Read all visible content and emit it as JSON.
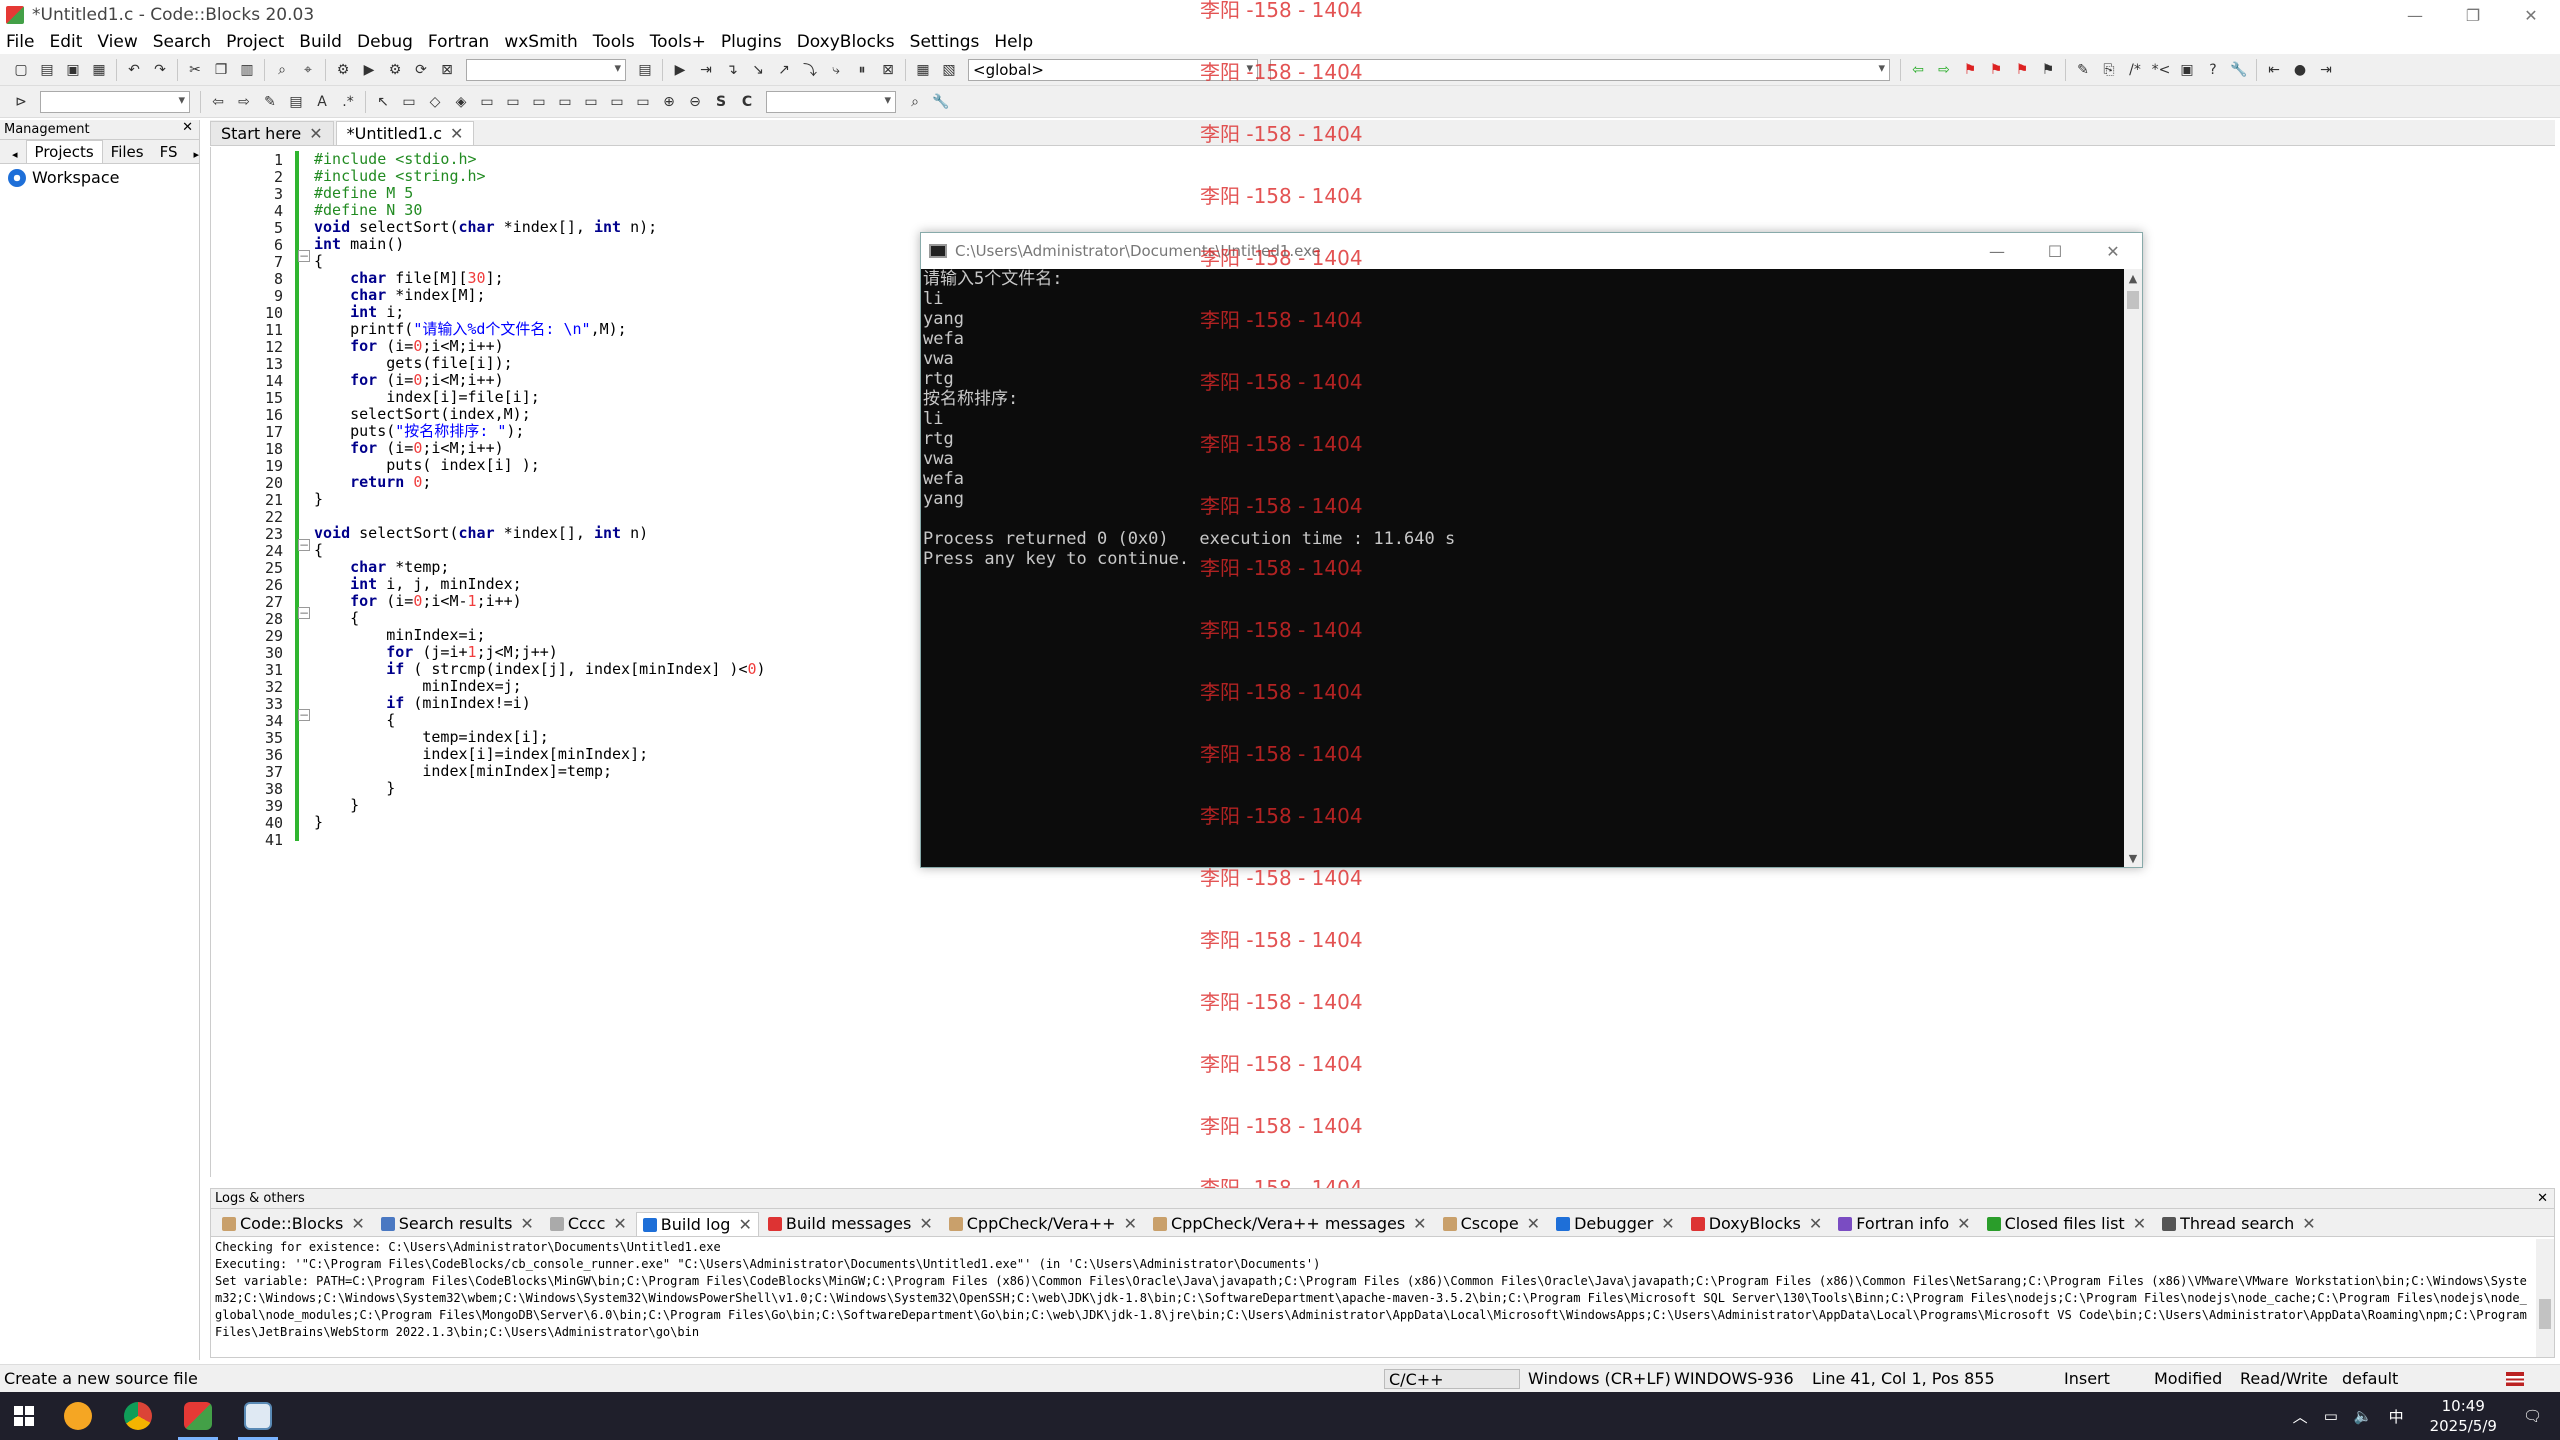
{
  "window": {
    "title": "*Untitled1.c - Code::Blocks 20.03",
    "controls": [
      "—",
      "❐",
      "✕"
    ]
  },
  "menu": [
    "File",
    "Edit",
    "View",
    "Search",
    "Project",
    "Build",
    "Debug",
    "Fortran",
    "wxSmith",
    "Tools",
    "Tools+",
    "Plugins",
    "DoxyBlocks",
    "Settings",
    "Help"
  ],
  "toolbar": {
    "scope_combo": "<global>"
  },
  "management": {
    "title": "Management",
    "tabs": [
      "Projects",
      "Files",
      "FS"
    ],
    "workspace": "Workspace"
  },
  "editor": {
    "tabs": [
      "Start here",
      "*Untitled1.c"
    ],
    "lines": [
      "#include <stdio.h>",
      "#include <string.h>",
      "#define M 5",
      "#define N 30",
      "void selectSort(char *index[], int n);",
      "int main()",
      "{",
      "    char file[M][30];",
      "    char *index[M];",
      "    int i;",
      "    printf(\"请输入%d个文件名: \\n\",M);",
      "    for (i=0;i<M;i++)",
      "        gets(file[i]);",
      "    for (i=0;i<M;i++)",
      "        index[i]=file[i];",
      "    selectSort(index,M);",
      "    puts(\"按名称排序: \");",
      "    for (i=0;i<M;i++)",
      "        puts( index[i] );",
      "    return 0;",
      "}",
      "",
      "void selectSort(char *index[], int n)",
      "{",
      "    char *temp;",
      "    int i, j, minIndex;",
      "    for (i=0;i<M-1;i++)",
      "    {",
      "        minIndex=i;",
      "        for (j=i+1;j<M;j++)",
      "        if ( strcmp(index[j], index[minIndex] )<0)",
      "            minIndex=j;",
      "        if (minIndex!=i)",
      "        {",
      "            temp=index[i];",
      "            index[i]=index[minIndex];",
      "            index[minIndex]=temp;",
      "        }",
      "    }",
      "}",
      ""
    ]
  },
  "console": {
    "title": "C:\\Users\\Administrator\\Documents\\Untitled1.exe",
    "output": "请输入5个文件名:\nli\nyang\nwefa\nvwa\nrtg\n按名称排序:\nli\nrtg\nvwa\nwefa\nyang\n\nProcess returned 0 (0x0)   execution time : 11.640 s\nPress any key to continue."
  },
  "watermark": "李阳 -158 - 1404",
  "logs": {
    "title": "Logs & others",
    "tabs": [
      "Code::Blocks",
      "Search results",
      "Cccc",
      "Build log",
      "Build messages",
      "CppCheck/Vera++",
      "CppCheck/Vera++ messages",
      "Cscope",
      "Debugger",
      "DoxyBlocks",
      "Fortran info",
      "Closed files list",
      "Thread search"
    ],
    "active_tab": "Build log",
    "text": "Checking for existence: C:\\Users\\Administrator\\Documents\\Untitled1.exe\nExecuting: '\"C:\\Program Files\\CodeBlocks/cb_console_runner.exe\" \"C:\\Users\\Administrator\\Documents\\Untitled1.exe\"' (in 'C:\\Users\\Administrator\\Documents')\nSet variable: PATH=C:\\Program Files\\CodeBlocks\\MinGW\\bin;C:\\Program Files\\CodeBlocks\\MinGW;C:\\Program Files (x86)\\Common Files\\Oracle\\Java\\javapath;C:\\Program Files (x86)\\Common Files\\Oracle\\Java\\javapath;C:\\Program Files (x86)\\Common Files\\NetSarang;C:\\Program Files (x86)\\VMware\\VMware Workstation\\bin;C:\\Windows\\System32;C:\\Windows;C:\\Windows\\System32\\wbem;C:\\Windows\\System32\\WindowsPowerShell\\v1.0;C:\\Windows\\System32\\OpenSSH;C:\\web\\JDK\\jdk-1.8\\bin;C:\\SoftwareDepartment\\apache-maven-3.5.2\\bin;C:\\Program Files\\Microsoft SQL Server\\130\\Tools\\Binn;C:\\Program Files\\nodejs;C:\\Program Files\\nodejs\\node_cache;C:\\Program Files\\nodejs\\node_global\\node_modules;C:\\Program Files\\MongoDB\\Server\\6.0\\bin;C:\\Program Files\\Go\\bin;C:\\SoftwareDepartment\\Go\\bin;C:\\web\\JDK\\jdk-1.8\\jre\\bin;C:\\Users\\Administrator\\AppData\\Local\\Microsoft\\WindowsApps;C:\\Users\\Administrator\\AppData\\Local\\Programs\\Microsoft VS Code\\bin;C:\\Users\\Administrator\\AppData\\Roaming\\npm;C:\\Program Files\\JetBrains\\WebStorm 2022.1.3\\bin;C:\\Users\\Administrator\\go\\bin"
  },
  "status": {
    "message": "Create a new source file",
    "language": "C/C++",
    "eol": "Windows (CR+LF)",
    "encoding": "WINDOWS-936",
    "position": "Line 41, Col 1, Pos 855",
    "mode": "Insert",
    "modified": "Modified",
    "access": "Read/Write",
    "profile": "default"
  },
  "taskbar": {
    "time": "10:49",
    "date": "2025/5/9",
    "ime": "中"
  },
  "colors": {
    "keyword": "#00008b",
    "string": "#0000ff",
    "preprocessor": "#228b22",
    "number": "#f03c3c",
    "watermark": "#dc2828",
    "console_bg": "#0c0c0c"
  }
}
